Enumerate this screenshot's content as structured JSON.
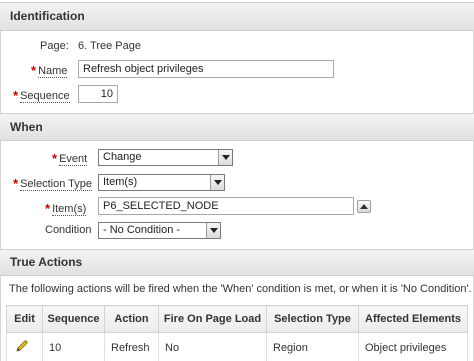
{
  "identification": {
    "title": "Identification",
    "page_label": "Page:",
    "page_value": "6. Tree Page",
    "name_label": "Name",
    "name_value": "Refresh object privileges",
    "sequence_label": "Sequence",
    "sequence_value": "10",
    "required_marker": "*"
  },
  "when": {
    "title": "When",
    "event_label": "Event",
    "event_value": "Change",
    "selection_type_label": "Selection Type",
    "selection_type_value": "Item(s)",
    "items_label": "Item(s)",
    "items_value": "P6_SELECTED_NODE",
    "condition_label": "Condition",
    "condition_value": "- No Condition -"
  },
  "true_actions": {
    "title": "True Actions",
    "description": "The following actions will be fired when the 'When' condition is met, or when it is 'No Condition'.",
    "columns": [
      "Edit",
      "Sequence",
      "Action",
      "Fire On Page Load",
      "Selection Type",
      "Affected Elements"
    ],
    "rows": [
      {
        "edit_icon": "pencil-icon",
        "sequence": "10",
        "action": "Refresh",
        "fire_on_page_load": "No",
        "selection_type": "Region",
        "affected_elements": "Object privileges"
      }
    ]
  },
  "colors": {
    "required": "#cc0000",
    "header_bg": "#e6e6e6",
    "border": "#cfcfcf"
  }
}
